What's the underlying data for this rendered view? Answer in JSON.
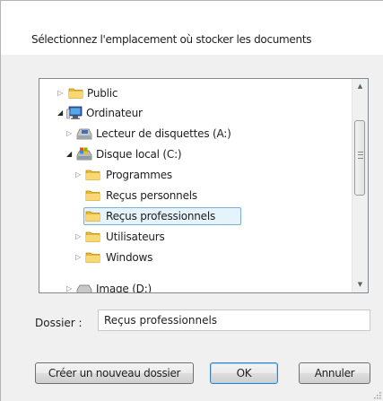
{
  "dialog": {
    "instruction": "Sélectionnez l'emplacement où stocker les documents"
  },
  "tree": {
    "items": [
      {
        "label": "Public",
        "icon": "folder-icon",
        "state": "collapsed"
      },
      {
        "label": "Ordinateur",
        "icon": "computer-icon",
        "state": "expanded"
      },
      {
        "label": "Lecteur de disquettes (A:)",
        "icon": "floppy-drive-icon",
        "state": "collapsed"
      },
      {
        "label": "Disque local (C:)",
        "icon": "local-disk-icon",
        "state": "expanded"
      },
      {
        "label": "Programmes",
        "icon": "folder-icon",
        "state": "collapsed"
      },
      {
        "label": "Reçus personnels",
        "icon": "folder-icon",
        "state": "leaf"
      },
      {
        "label": "Reçus professionnels",
        "icon": "folder-icon",
        "state": "leaf",
        "selected": true
      },
      {
        "label": "Utilisateurs",
        "icon": "folder-icon",
        "state": "collapsed"
      },
      {
        "label": "Windows",
        "icon": "folder-icon",
        "state": "collapsed"
      },
      {
        "label": "Image (D:)",
        "icon": "drive-icon",
        "state": "collapsed"
      }
    ]
  },
  "folder_field": {
    "label": "Dossier :",
    "value": "Reçus professionnels"
  },
  "buttons": {
    "new_folder": "Créer un nouveau dossier",
    "ok": "OK",
    "cancel": "Annuler"
  },
  "colors": {
    "folder": "#e8b830",
    "selection_bg": "#e5f3fb",
    "selection_border": "#7ab0d6",
    "default_button_border": "#3c7fb1"
  }
}
